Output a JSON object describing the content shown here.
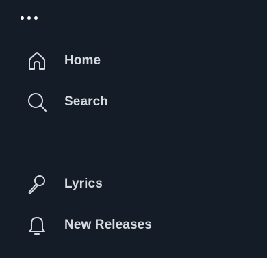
{
  "menu": {
    "more_icon": "more-horizontal-icon"
  },
  "nav": {
    "items": [
      {
        "label": "Home",
        "icon": "home-icon"
      },
      {
        "label": "Search",
        "icon": "search-icon"
      },
      {
        "label": "Lyrics",
        "icon": "microphone-icon"
      },
      {
        "label": "New Releases",
        "icon": "bell-icon"
      }
    ]
  },
  "colors": {
    "background": "#141c27",
    "text": "#d7dbe0"
  }
}
